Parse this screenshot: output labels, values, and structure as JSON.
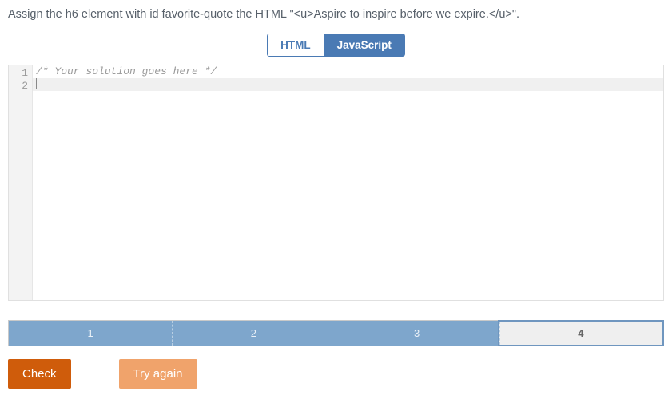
{
  "prompt": "Assign the h6 element with id favorite-quote the HTML \"<u>Aspire to inspire before we expire.</u>\".",
  "tabs": {
    "html": "HTML",
    "js": "JavaScript",
    "active": "js"
  },
  "editor": {
    "lines": [
      {
        "num": "1",
        "text": "/* Your solution goes here */",
        "type": "comment",
        "highlight": false
      },
      {
        "num": "2",
        "text": "",
        "type": "plain",
        "highlight": true
      }
    ]
  },
  "progress": {
    "segments": [
      {
        "label": "1",
        "state": "done"
      },
      {
        "label": "2",
        "state": "done"
      },
      {
        "label": "3",
        "state": "done"
      },
      {
        "label": "4",
        "state": "current"
      }
    ]
  },
  "buttons": {
    "check": "Check",
    "retry": "Try again"
  }
}
